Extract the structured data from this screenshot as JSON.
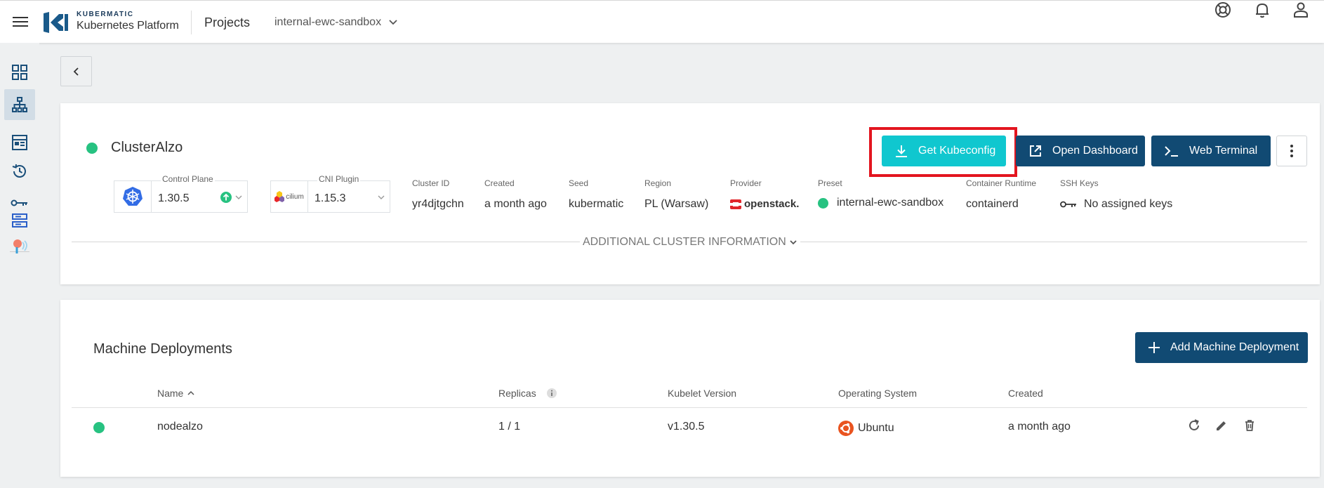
{
  "header": {
    "brand_top": "KUBERMATIC",
    "brand_bottom": "Kubernetes Platform",
    "projects_label": "Projects",
    "project_name": "internal-ewc-sandbox",
    "icons": [
      "help-icon",
      "bell-icon",
      "user-icon"
    ]
  },
  "sidebar": {
    "items": [
      "dashboard-icon",
      "clusters-icon",
      "templates-icon",
      "history-icon",
      "key-icon",
      "backup-icon",
      "cloud-icon"
    ]
  },
  "cluster": {
    "name": "ClusterAlzo",
    "status_color": "#27c281",
    "buttons": {
      "kubeconfig": "Get Kubeconfig",
      "dashboard": "Open Dashboard",
      "terminal": "Web Terminal"
    },
    "control_plane": {
      "label": "Control Plane",
      "value": "1.30.5"
    },
    "cni": {
      "label": "CNI Plugin",
      "value": "1.15.3",
      "logo_text": "cilium"
    },
    "meta": [
      {
        "label": "Cluster ID",
        "value": "yr4djtgchn"
      },
      {
        "label": "Created",
        "value": "a month ago"
      },
      {
        "label": "Seed",
        "value": "kubermatic"
      },
      {
        "label": "Region",
        "value": "PL (Warsaw)"
      },
      {
        "label": "Provider",
        "value": "openstack."
      },
      {
        "label": "Preset",
        "value": "internal-ewc-sandbox"
      },
      {
        "label": "Container Runtime",
        "value": "containerd"
      },
      {
        "label": "SSH Keys",
        "value": "No assigned keys"
      }
    ],
    "additional_info": "ADDITIONAL CLUSTER INFORMATION"
  },
  "machine_deployments": {
    "title": "Machine Deployments",
    "add_button": "Add Machine Deployment",
    "columns": [
      "Name",
      "Replicas",
      "Kubelet Version",
      "Operating System",
      "Created"
    ],
    "rows": [
      {
        "name": "nodealzo",
        "replicas": "1 / 1",
        "kubelet": "v1.30.5",
        "os": "Ubuntu",
        "created": "a month ago"
      }
    ]
  },
  "colors": {
    "primary": "#114a73",
    "accent": "#10c7cf",
    "highlight": "#e3151f",
    "success": "#27c281"
  }
}
